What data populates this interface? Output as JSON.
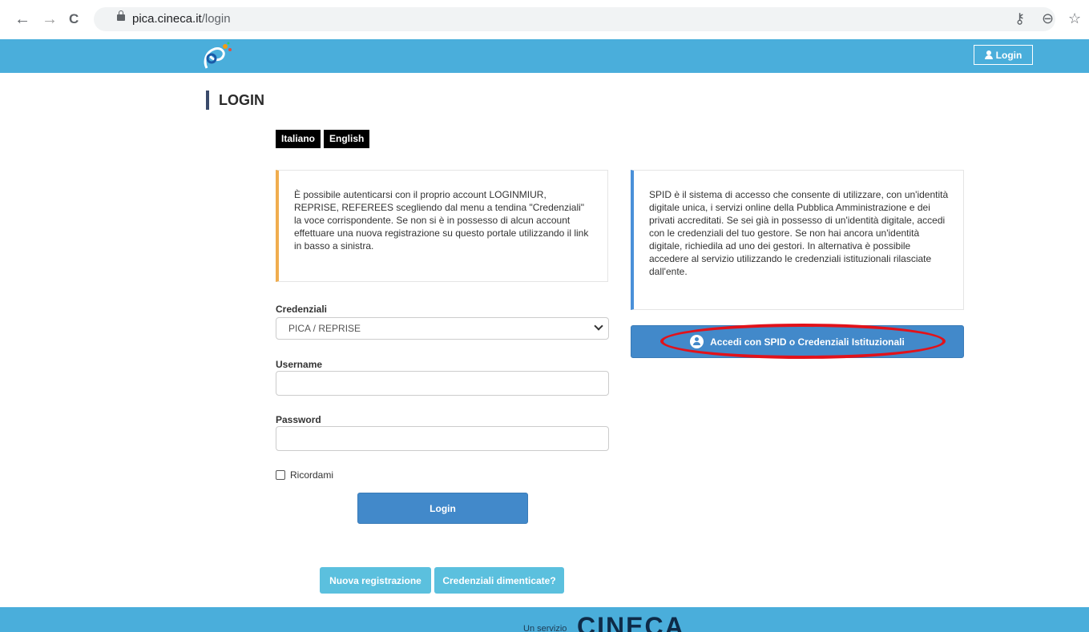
{
  "browser": {
    "url_domain": "pica.cineca.it",
    "url_path": "/login",
    "back_glyph": "←",
    "forward_glyph": "→",
    "reload_glyph": "C",
    "key_glyph": "⚷",
    "zoom_glyph": "⊖",
    "star_glyph": "☆"
  },
  "header": {
    "login_label": "Login",
    "colors": {
      "bar": "#4aaedb"
    }
  },
  "page": {
    "title": "LOGIN",
    "languages": [
      "Italiano",
      "English"
    ]
  },
  "info_left": {
    "text": "È possibile autenticarsi con il proprio account LOGINMIUR, REPRISE, REFEREES scegliendo dal menu a tendina \"Credenziali\" la voce corrispondente. Se non si è in possesso di alcun account effettuare una nuova registrazione su questo portale utilizzando il link in basso a sinistra."
  },
  "info_right": {
    "text": "SPID è il sistema di accesso che consente di utilizzare, con un'identità digitale unica, i servizi online della Pubblica Amministrazione e dei privati accreditati. Se sei già in possesso di un'identità digitale, accedi con le credenziali del tuo gestore. Se non hai ancora un'identità digitale, richiedila ad uno dei gestori. In alternativa è possibile accedere al servizio utilizzando le credenziali istituzionali rilasciate dall'ente."
  },
  "form": {
    "credentials_label": "Credenziali",
    "credentials_selected": "PICA / REPRISE",
    "username_label": "Username",
    "username_value": "",
    "password_label": "Password",
    "password_value": "",
    "remember_label": "Ricordami",
    "login_button": "Login"
  },
  "spid": {
    "button_label": "Accedi con SPID o Credenziali Istituzionali",
    "highlight_color": "#e2121a"
  },
  "links": {
    "register": "Nuova registrazione",
    "forgot": "Credenziali dimenticate?"
  },
  "footer": {
    "prefix": "Un servizio",
    "brand": "CINECA"
  }
}
